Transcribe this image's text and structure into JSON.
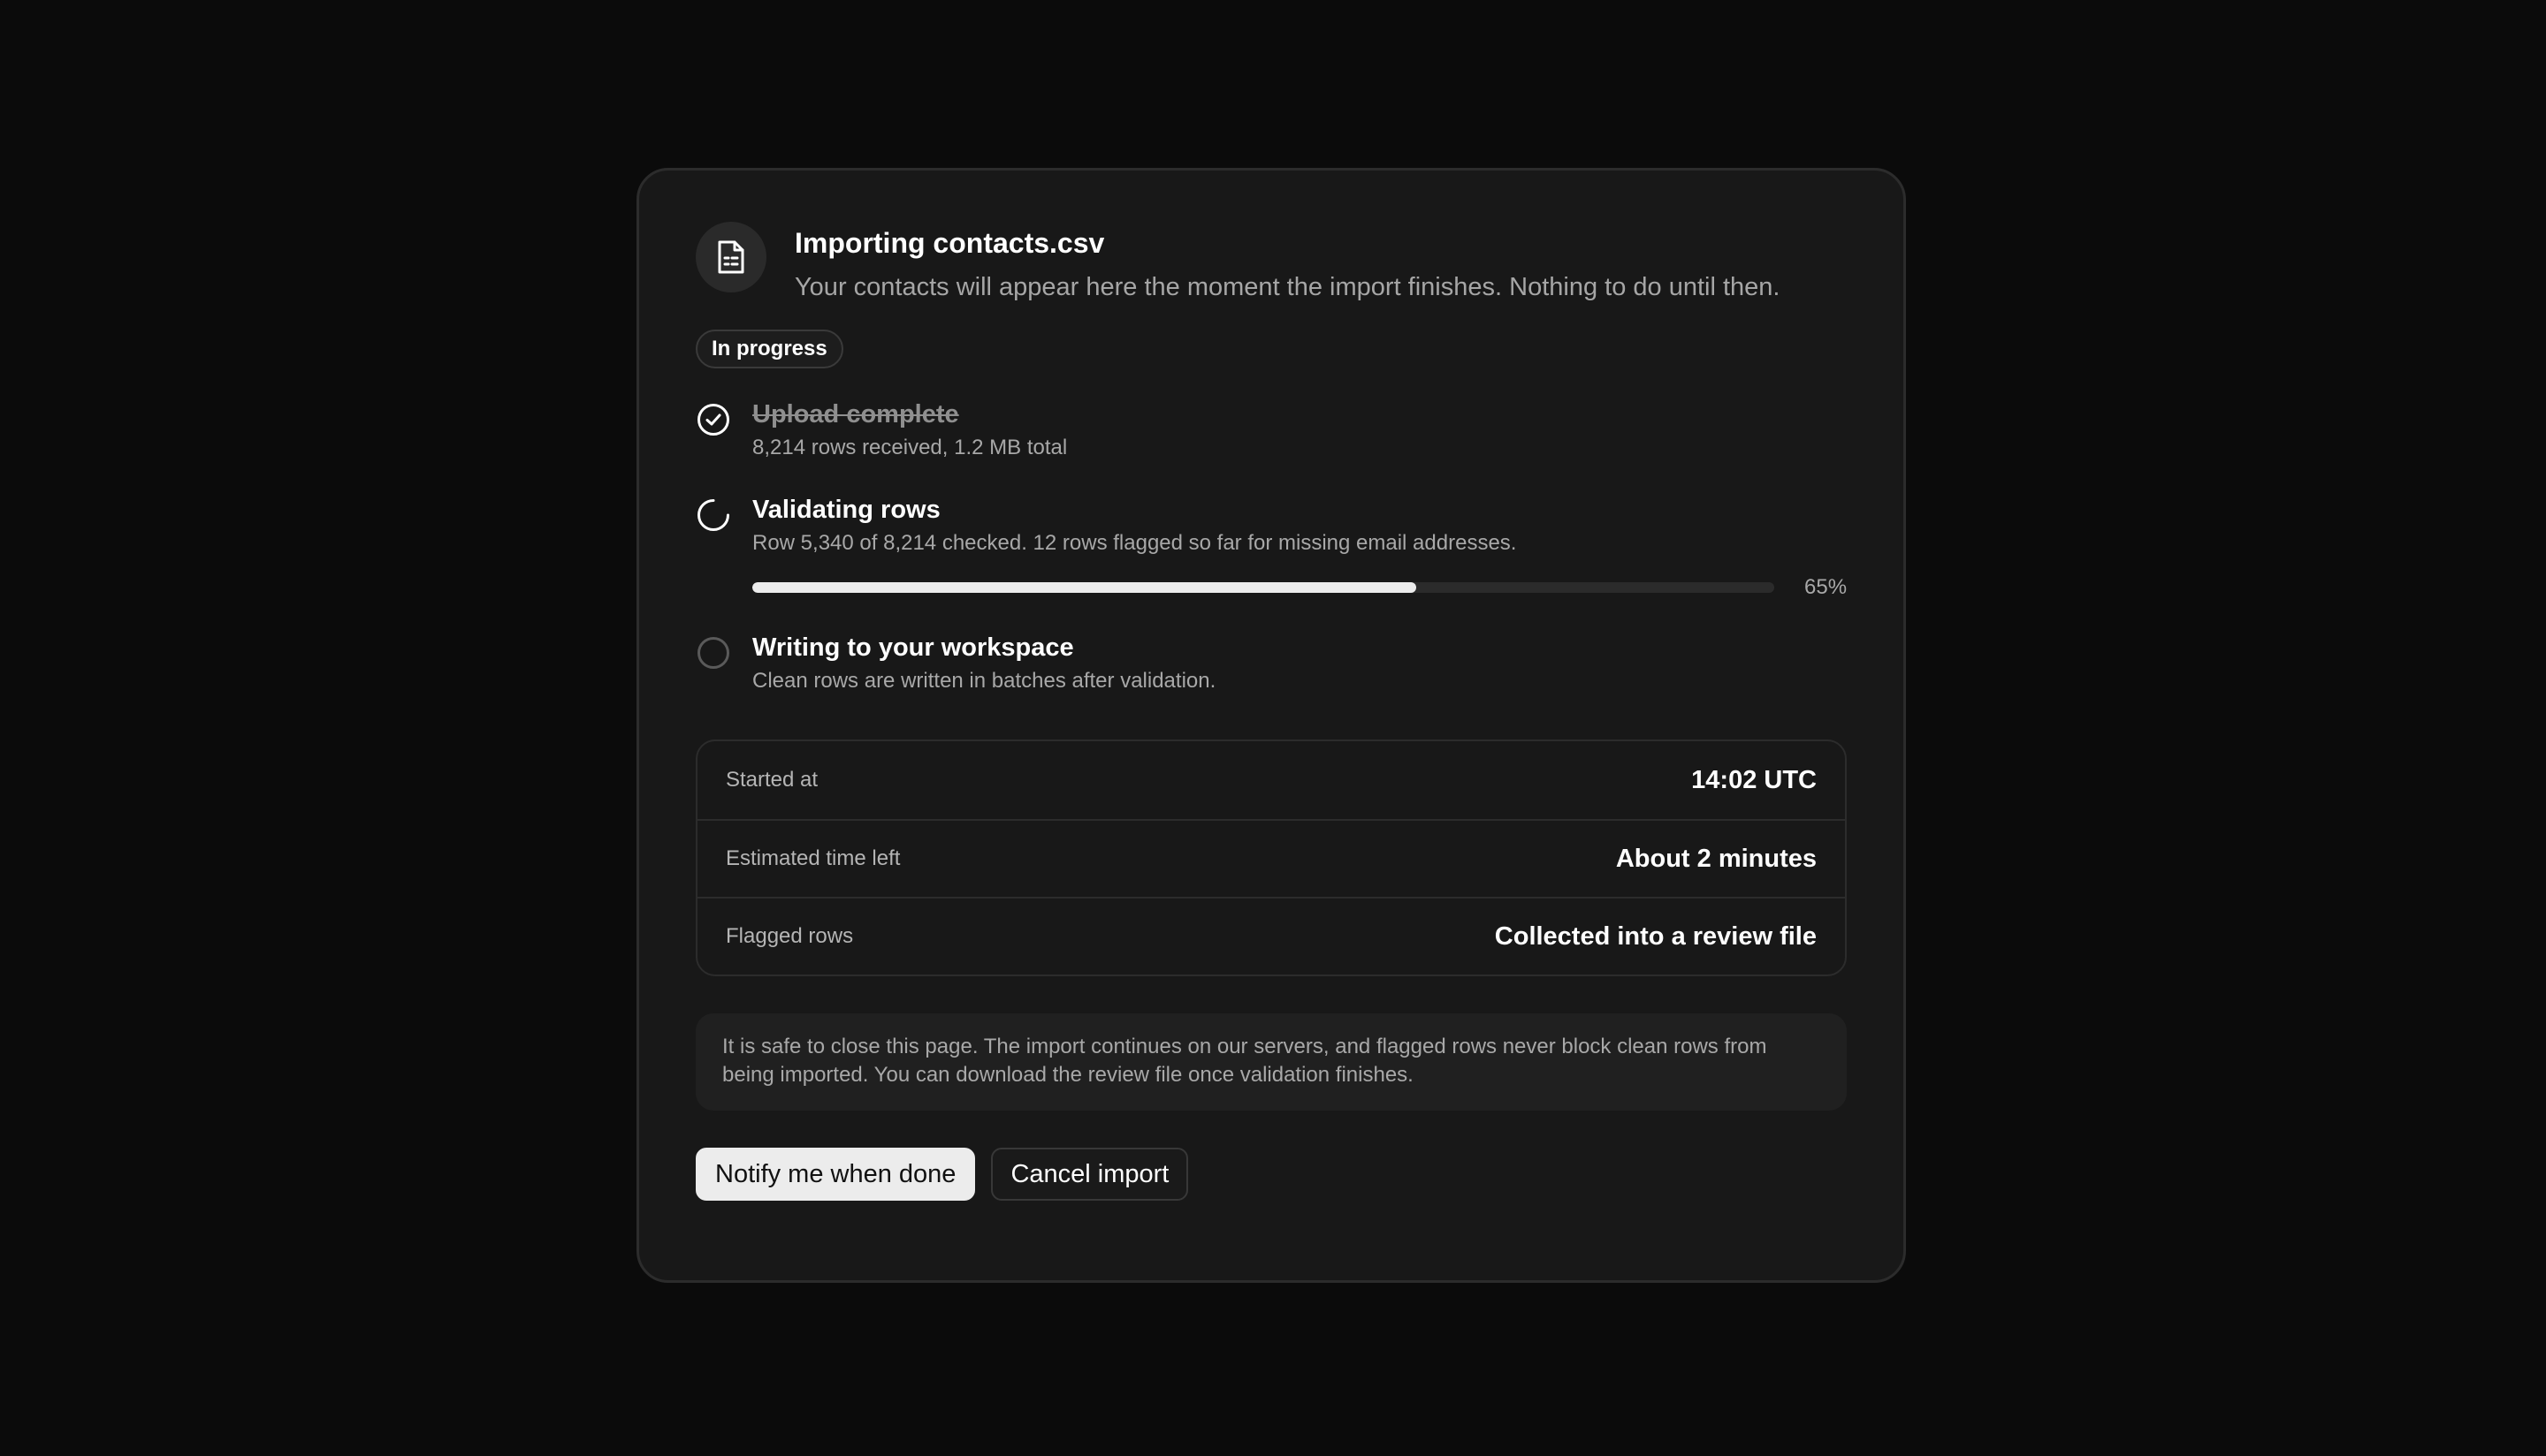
{
  "dialog": {
    "title": "Importing contacts.csv",
    "subtitle": "Your contacts will appear here the moment the import finishes. Nothing to do until then.",
    "status_badge": "In progress",
    "icon": "file-text-icon"
  },
  "steps": [
    {
      "state": "complete",
      "icon": "check-circle-icon",
      "title": "Upload complete",
      "description": "8,214 rows received, 1.2 MB total"
    },
    {
      "state": "active",
      "icon": "spinner-icon",
      "title": "Validating rows",
      "description": "Row 5,340 of 8,214 checked. 12 rows flagged so far for missing email addresses.",
      "progress": 0.65,
      "progress_label": "65%"
    },
    {
      "state": "pending",
      "icon": "empty-circle-icon",
      "title": "Writing to your workspace",
      "description": "Clean rows are written in batches after validation."
    }
  ],
  "details": [
    {
      "label": "Started at",
      "value": "14:02 UTC"
    },
    {
      "label": "Estimated time left",
      "value": "About 2 minutes"
    },
    {
      "label": "Flagged rows",
      "value": "Collected into a review file"
    }
  ],
  "note": "It is safe to close this page. The import continues on our servers, and flagged rows never block clean rows from being imported. You can download the review file once validation finishes.",
  "actions": {
    "primary_label": "Notify me when done",
    "secondary_label": "Cancel import"
  },
  "colors": {
    "background": "#0b0b0b",
    "card": "#181818",
    "accent": "#ececec",
    "muted_text": "#a8a8a8"
  }
}
